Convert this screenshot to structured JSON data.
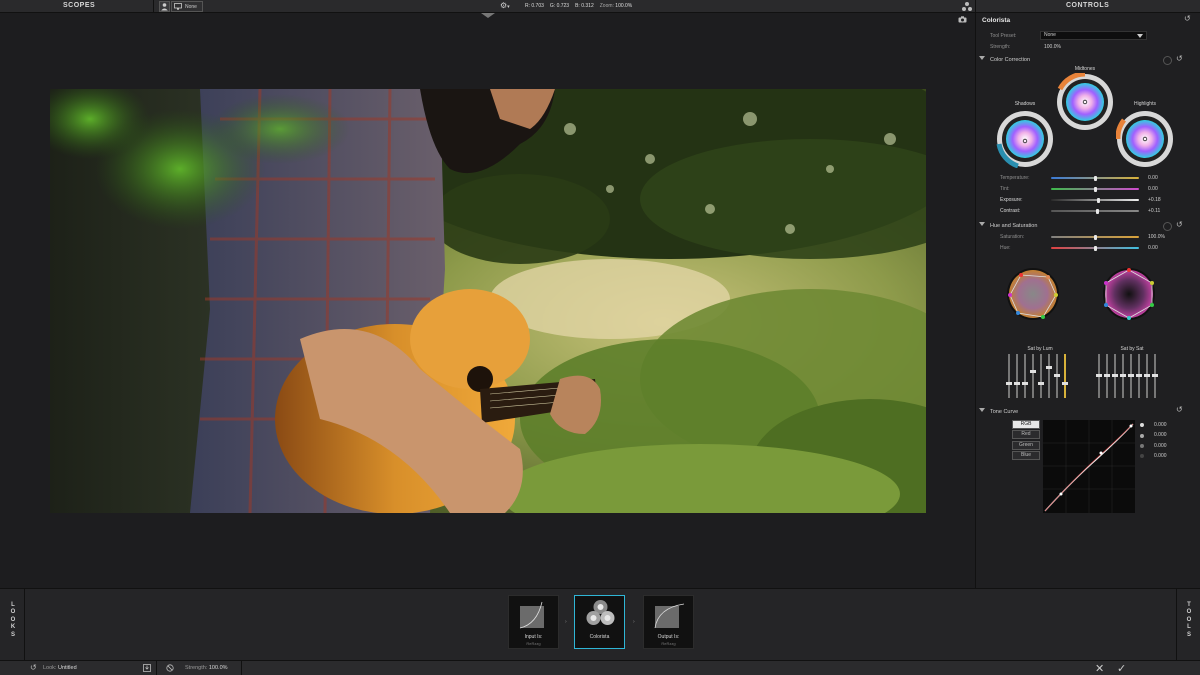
{
  "topbar": {
    "scopes_label": "SCOPES",
    "controls_label": "CONTROLS",
    "monitor_value": "None",
    "readout": {
      "r": "R: 0.703",
      "g": "G: 0.723",
      "b": "B: 0.312",
      "zoom_label": "Zoom:",
      "zoom_value": "100.0%"
    }
  },
  "panel": {
    "title": "Colorista",
    "tool_preset_label": "Tool Preset:",
    "tool_preset_value": "None",
    "strength_label": "Strength:",
    "strength_value": "100.0%",
    "color_correction": {
      "header": "Color Correction",
      "wheels": {
        "shadows": "Shadows",
        "midtones": "Midtones",
        "highlights": "Highlights"
      },
      "sliders": [
        {
          "label": "Temperature:",
          "value": "0.00",
          "pos": 0.5,
          "colors": [
            "#3a7ad6",
            "#d9b23a"
          ]
        },
        {
          "label": "Tint:",
          "value": "0.00",
          "pos": 0.5,
          "colors": [
            "#3dbb4a",
            "#d04ad0"
          ]
        },
        {
          "label": "Exposure:",
          "value": "+0.18",
          "pos": 0.54,
          "colors": [
            "#2a2a2a",
            "#eeeeee"
          ]
        },
        {
          "label": "Contrast:",
          "value": "+0.11",
          "pos": 0.53,
          "colors": [
            "#555555",
            "#888888"
          ]
        }
      ]
    },
    "hue_saturation": {
      "header": "Hue and Saturation",
      "sliders": [
        {
          "label": "Saturation:",
          "value": "100.0%",
          "pos": 0.5,
          "colors": [
            "#808080",
            "#d9a23a"
          ]
        },
        {
          "label": "Hue:",
          "value": "0.00",
          "pos": 0.5,
          "colors": [
            "#e04040",
            "#40c0e0"
          ]
        }
      ],
      "sat_by_lum_label": "Sat by Lum",
      "sat_by_sat_label": "Sat by Sat",
      "sat_by_lum_levels": [
        0.3,
        0.3,
        0.3,
        0.6,
        0.3,
        0.7,
        0.5,
        0.3
      ],
      "sat_by_sat_levels": [
        0.5,
        0.5,
        0.5,
        0.5,
        0.5,
        0.5,
        0.5,
        0.5
      ]
    },
    "tone_curve": {
      "header": "Tone Curve",
      "channels": [
        "RGB",
        "Red",
        "Green",
        "Blue"
      ],
      "active_channel": "RGB",
      "values": [
        "0.000",
        "0.000",
        "0.000",
        "0.000"
      ]
    }
  },
  "strip": {
    "looks_label": "LOOKS",
    "tools_label": "TOOLS",
    "nodes": [
      {
        "label": "Input Is:",
        "sub": "ReRzzg"
      },
      {
        "label": "Colorista",
        "sub": ""
      },
      {
        "label": "Output Is:",
        "sub": "ReRzzg"
      }
    ]
  },
  "status": {
    "look_label": "Look:",
    "look_value": "Untitled",
    "strength_label": "Strength:",
    "strength_value": "100.0%"
  }
}
